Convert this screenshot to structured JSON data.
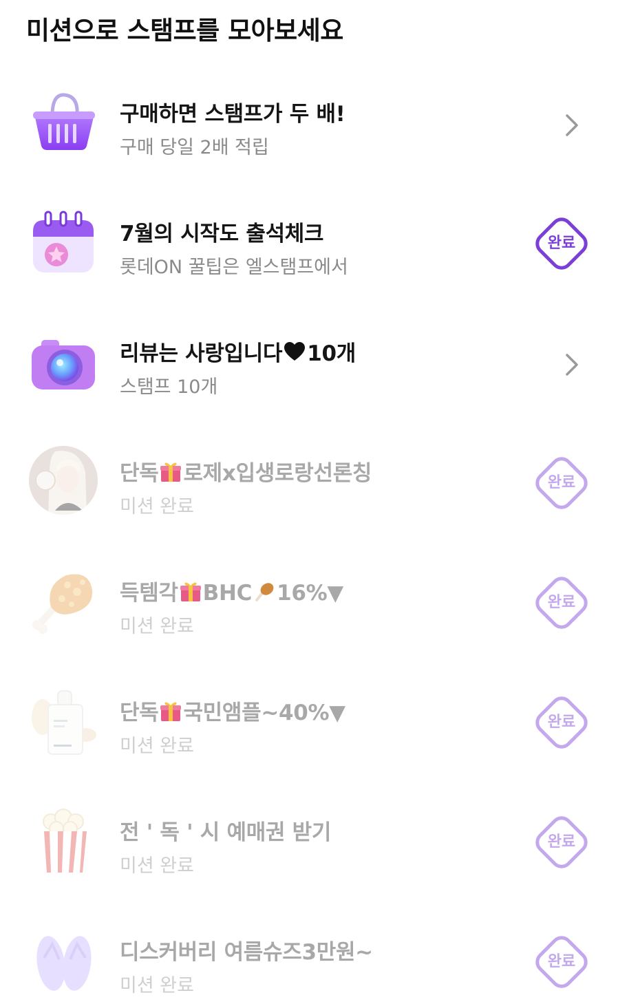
{
  "page": {
    "title": "미션으로 스탬프를 모아보세요"
  },
  "colors": {
    "accent": "#7b3fd8",
    "done_text": "#a8a8a8",
    "sub_text": "#8a8a8a"
  },
  "missions": [
    {
      "icon": "shopping-basket-icon",
      "title": "구매하면 스탬프가 두 배!",
      "subtitle": "구매 당일 2배 적립",
      "action": "chevron"
    },
    {
      "icon": "calendar-icon",
      "title": "7월의 시작도 출석체크",
      "subtitle": "롯데ON 꿀팁은 엘스탬프에서",
      "action": "badge",
      "badge_label": "완료"
    },
    {
      "icon": "camera-icon",
      "title_prefix": "리뷰는 사랑입니다",
      "title_suffix": "10개",
      "title_icon": "heart-icon",
      "subtitle": "스탬프 10개",
      "action": "chevron"
    },
    {
      "icon": "rose-portrait-thumbnail",
      "title_prefix": "단독",
      "title_suffix": "로제x입생로랑선론칭",
      "title_icon": "gift-icon",
      "subtitle": "미션 완료",
      "action": "badge",
      "badge_label": "완료",
      "done": true
    },
    {
      "icon": "fried-chicken-icon",
      "title_prefix": "득템각",
      "title_middle": "BHC",
      "title_suffix": "16%▼",
      "title_icon": "gift-icon",
      "title_icon2": "drumstick-icon",
      "subtitle": "미션 완료",
      "action": "badge",
      "badge_label": "완료",
      "done": true
    },
    {
      "icon": "ampoule-bottle-icon",
      "title_prefix": "단독",
      "title_suffix": "국민앰플~40%▼",
      "title_icon": "gift-icon",
      "subtitle": "미션 완료",
      "action": "badge",
      "badge_label": "완료",
      "done": true
    },
    {
      "icon": "popcorn-icon",
      "title": "전 ' 독 ' 시 예매권 받기",
      "subtitle": "미션 완료",
      "action": "badge",
      "badge_label": "완료",
      "done": true
    },
    {
      "icon": "flip-flops-icon",
      "title": "디스커버리 여름슈즈3만원~",
      "subtitle": "미션 완료",
      "action": "badge",
      "badge_label": "완료",
      "done": true
    }
  ]
}
